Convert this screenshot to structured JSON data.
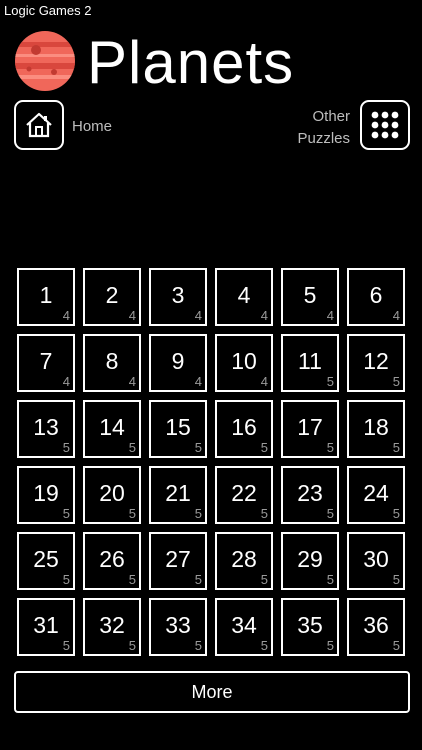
{
  "status_bar": {
    "app_name": "Logic Games 2"
  },
  "header": {
    "title": "Planets",
    "icon": "planet-icon"
  },
  "nav": {
    "home_label": "Home",
    "home_icon": "house-icon",
    "other_label_line1": "Other",
    "other_label_line2": "Puzzles",
    "other_icon": "grid-dots-icon"
  },
  "levels": [
    {
      "number": "1",
      "size": "4"
    },
    {
      "number": "2",
      "size": "4"
    },
    {
      "number": "3",
      "size": "4"
    },
    {
      "number": "4",
      "size": "4"
    },
    {
      "number": "5",
      "size": "4"
    },
    {
      "number": "6",
      "size": "4"
    },
    {
      "number": "7",
      "size": "4"
    },
    {
      "number": "8",
      "size": "4"
    },
    {
      "number": "9",
      "size": "4"
    },
    {
      "number": "10",
      "size": "4"
    },
    {
      "number": "11",
      "size": "5"
    },
    {
      "number": "12",
      "size": "5"
    },
    {
      "number": "13",
      "size": "5"
    },
    {
      "number": "14",
      "size": "5"
    },
    {
      "number": "15",
      "size": "5"
    },
    {
      "number": "16",
      "size": "5"
    },
    {
      "number": "17",
      "size": "5"
    },
    {
      "number": "18",
      "size": "5"
    },
    {
      "number": "19",
      "size": "5"
    },
    {
      "number": "20",
      "size": "5"
    },
    {
      "number": "21",
      "size": "5"
    },
    {
      "number": "22",
      "size": "5"
    },
    {
      "number": "23",
      "size": "5"
    },
    {
      "number": "24",
      "size": "5"
    },
    {
      "number": "25",
      "size": "5"
    },
    {
      "number": "26",
      "size": "5"
    },
    {
      "number": "27",
      "size": "5"
    },
    {
      "number": "28",
      "size": "5"
    },
    {
      "number": "29",
      "size": "5"
    },
    {
      "number": "30",
      "size": "5"
    },
    {
      "number": "31",
      "size": "5"
    },
    {
      "number": "32",
      "size": "5"
    },
    {
      "number": "33",
      "size": "5"
    },
    {
      "number": "34",
      "size": "5"
    },
    {
      "number": "35",
      "size": "5"
    },
    {
      "number": "36",
      "size": "5"
    }
  ],
  "more": {
    "label": "More"
  },
  "colors": {
    "background": "#000000",
    "foreground": "#ffffff",
    "muted": "#9a9a9a",
    "planet": "#f0675a"
  }
}
